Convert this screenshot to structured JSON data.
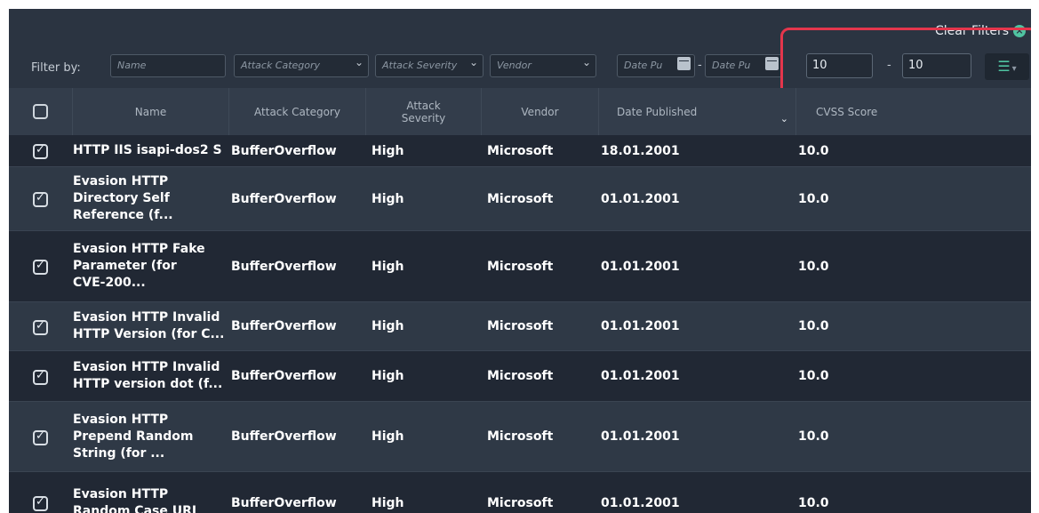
{
  "toolbar": {
    "clear_filters_label": "Clear Filters"
  },
  "filters": {
    "label": "Filter by:",
    "name_placeholder": "Name",
    "attack_category_placeholder": "Attack Category",
    "attack_severity_placeholder": "Attack Severity",
    "vendor_placeholder": "Vendor",
    "date_from_placeholder": "Date Pu",
    "date_to_placeholder": "Date Pu",
    "date_separator": "-",
    "cvss_min": "10",
    "cvss_max": "10",
    "range_separator": "-"
  },
  "columns": {
    "name": "Name",
    "attack_category": "Attack Category",
    "attack_severity": "Attack Severity",
    "vendor": "Vendor",
    "date_published": "Date Published",
    "cvss_score": "CVSS Score"
  },
  "rows": [
    {
      "name": "HTTP IIS isapi-dos2 S",
      "category": "BufferOverflow",
      "severity": "High",
      "vendor": "Microsoft",
      "date": "18.01.2001",
      "cvss": "10.0",
      "checked": true
    },
    {
      "name": "Evasion HTTP\nDirectory Self\nReference (f...",
      "category": "BufferOverflow",
      "severity": "High",
      "vendor": "Microsoft",
      "date": "01.01.2001",
      "cvss": "10.0",
      "checked": true
    },
    {
      "name": "Evasion HTTP Fake\nParameter (for\nCVE-200...",
      "category": "BufferOverflow",
      "severity": "High",
      "vendor": "Microsoft",
      "date": "01.01.2001",
      "cvss": "10.0",
      "checked": true
    },
    {
      "name": "Evasion HTTP Invalid\nHTTP Version (for C...",
      "category": "BufferOverflow",
      "severity": "High",
      "vendor": "Microsoft",
      "date": "01.01.2001",
      "cvss": "10.0",
      "checked": true
    },
    {
      "name": "Evasion HTTP Invalid\nHTTP version dot (f...",
      "category": "BufferOverflow",
      "severity": "High",
      "vendor": "Microsoft",
      "date": "01.01.2001",
      "cvss": "10.0",
      "checked": true
    },
    {
      "name": "Evasion HTTP\nPrepend Random\nString (for ...",
      "category": "BufferOverflow",
      "severity": "High",
      "vendor": "Microsoft",
      "date": "01.01.2001",
      "cvss": "10.0",
      "checked": true
    },
    {
      "name": "Evasion HTTP\nRandom Case URL",
      "category": "BufferOverflow",
      "severity": "High",
      "vendor": "Microsoft",
      "date": "01.01.2001",
      "cvss": "10.0",
      "checked": true
    }
  ]
}
